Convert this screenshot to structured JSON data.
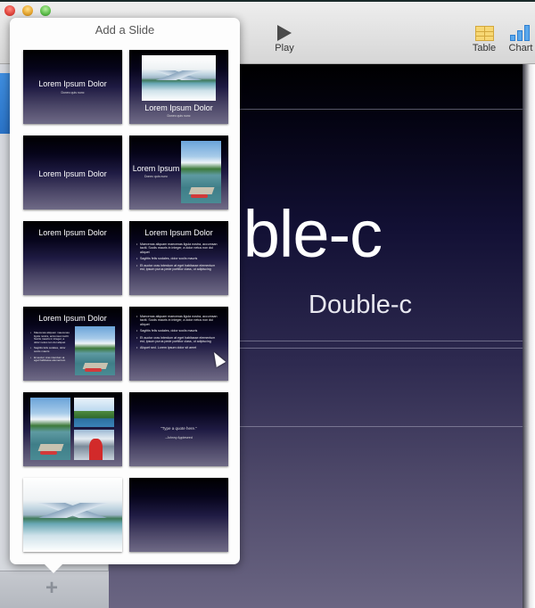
{
  "window": {
    "traffic_lights": [
      "close",
      "minimize",
      "zoom"
    ]
  },
  "toolbar": {
    "play_label": "Play",
    "table_label": "Table",
    "chart_label": "Chart"
  },
  "popover": {
    "title": "Add a Slide",
    "slides": [
      {
        "layout": "title-subtitle",
        "title": "Lorem Ipsum Dolor",
        "subtitle": "Donec quis nunc"
      },
      {
        "layout": "photo-title-subtitle",
        "title": "Lorem Ipsum Dolor",
        "subtitle": "Donec quis nunc"
      },
      {
        "layout": "title-center",
        "title": "Lorem Ipsum Dolor"
      },
      {
        "layout": "title-subtitle-photo-vertical",
        "title": "Lorem Ipsum",
        "subtitle": "Donec quis nunc"
      },
      {
        "layout": "title-top",
        "title": "Lorem Ipsum Dolor"
      },
      {
        "layout": "title-bullets",
        "title": "Lorem Ipsum Dolor",
        "bullets": [
          "Maecenas aliquam maecenas ligula nostra, accumsan taciti. Sociis mauris in integer, a dolor netus non dui aliquet",
          "Sagittis felis sodales, dolor sociis mauris",
          "Et auctor cras interdum at eget habitasse elementum est, ipsum purus pede porttitor class, ut adipiscing"
        ]
      },
      {
        "layout": "title-bullets-photo",
        "title": "Lorem Ipsum Dolor",
        "bullets": [
          "Maecenas aliquam maecenas ligula nostra, accumsan taciti. Sociis mauris in integer, a dolor netus non dui aliquet",
          "Sagittis felis sodales, dolor sociis mauris",
          "Et auctor cras interdum at eget habitasse elementum"
        ]
      },
      {
        "layout": "bullets",
        "bullets": [
          "Maecenas aliquam maecenas ligula nostra, accumsan taciti. Sociis mauris in integer, a dolor netus non dui aliquet",
          "Sagittis felis sodales, dolor sociis mauris",
          "Et auctor cras interdum at eget habitasse elementum est, ipsum purus pede porttitor class, ut adipiscing",
          "Aliquet sed. Lorem ipsum dolor sit amet"
        ]
      },
      {
        "layout": "photos-3"
      },
      {
        "layout": "quote",
        "quote": "“Type a quote here.”",
        "attribution": "–Johnny Appleseed"
      },
      {
        "layout": "photo"
      },
      {
        "layout": "blank"
      }
    ]
  },
  "slide": {
    "title": "Double-c",
    "subtitle": "Double-c"
  },
  "sidebar": {
    "add_slide_label": "+"
  }
}
